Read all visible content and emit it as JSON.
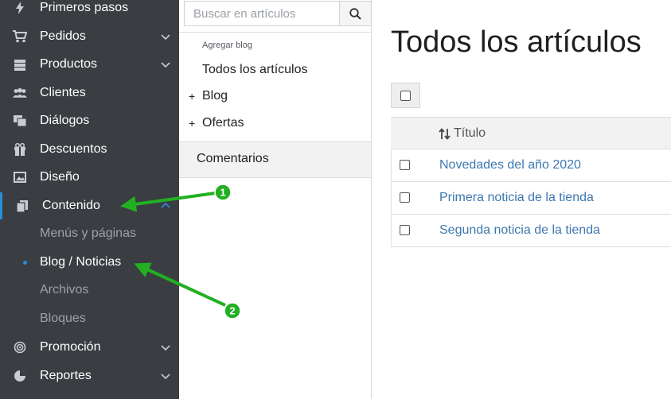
{
  "sidebar": {
    "items": [
      {
        "label": "Primeros pasos",
        "icon": "lightning-icon"
      },
      {
        "label": "Pedidos",
        "icon": "cart-icon"
      },
      {
        "label": "Productos",
        "icon": "box-icon"
      },
      {
        "label": "Clientes",
        "icon": "users-icon"
      },
      {
        "label": "Diálogos",
        "icon": "chat-icon"
      },
      {
        "label": "Descuentos",
        "icon": "gift-icon"
      },
      {
        "label": "Diseño",
        "icon": "image-icon"
      },
      {
        "label": "Contenido",
        "icon": "documents-icon"
      },
      {
        "label": "Promoción",
        "icon": "target-icon"
      },
      {
        "label": "Reportes",
        "icon": "pie-chart-icon"
      }
    ],
    "sub_items": [
      {
        "label": "Menús y páginas"
      },
      {
        "label": "Blog / Noticias"
      },
      {
        "label": "Archivos"
      },
      {
        "label": "Bloques"
      }
    ],
    "accent_color": "#2e8bd8"
  },
  "midpanel": {
    "search": {
      "placeholder": "Buscar en artículos"
    },
    "add_blog": "Agregar blog",
    "tree": [
      {
        "label": "Todos los artículos",
        "prefix": ""
      },
      {
        "label": "Blog",
        "prefix": "+"
      },
      {
        "label": "Ofertas",
        "prefix": "+"
      }
    ],
    "comments": "Comentarios"
  },
  "main": {
    "title": "Todos los artículos",
    "table": {
      "header_title": "Título",
      "rows": [
        {
          "title": "Novedades del año 2020"
        },
        {
          "title": "Primera noticia de la tienda"
        },
        {
          "title": "Segunda noticia de la tienda"
        }
      ]
    }
  },
  "annotations": {
    "color": "#22b022",
    "callouts": [
      {
        "number": "1"
      },
      {
        "number": "2"
      }
    ]
  }
}
